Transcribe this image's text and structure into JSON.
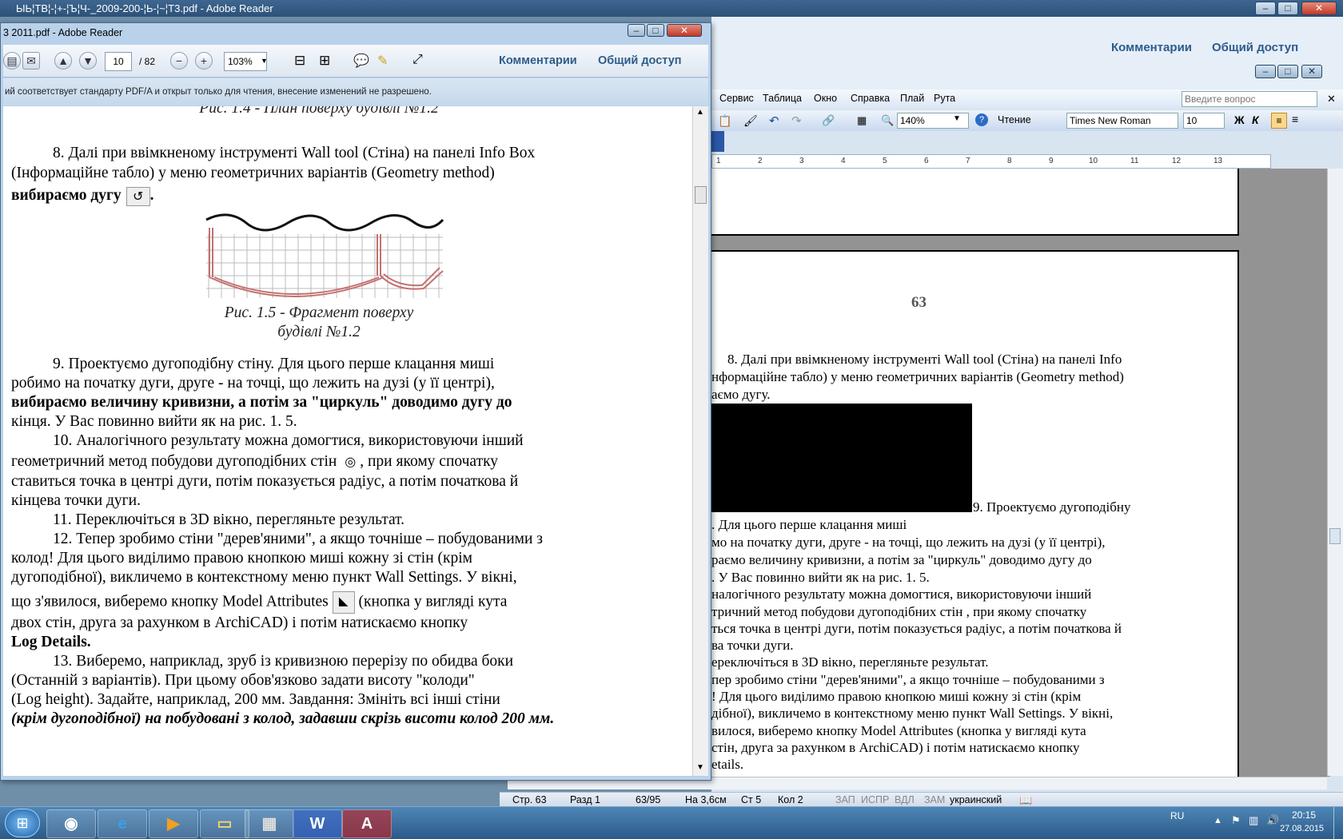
{
  "background_window": {
    "title": "ЫЬ¦ТВ¦-¦+-¦Ъ¦Ч-_2009-200-¦Ь-¦~¦Т3.pdf - Adobe Reader",
    "links": [
      "Комментарии",
      "Общий доступ"
    ]
  },
  "word": {
    "menu": [
      "Сервис",
      "Таблица",
      "Окно",
      "Справка",
      "Плай",
      "Рута"
    ],
    "search_placeholder": "Введите вопрос",
    "zoom": "140%",
    "view_mode": "Чтение",
    "font_name": "Times New Roman",
    "font_size": "10",
    "bold": "Ж",
    "italic": "К",
    "ruler_ticks": [
      "1",
      "2",
      "3",
      "4",
      "5",
      "6",
      "7",
      "8",
      "9",
      "10",
      "11",
      "12",
      "13"
    ],
    "page_number": "63",
    "lines": [
      "8. Далі при ввімкненому інструменті Wall tool (Стіна) на панелі Info",
      "нформаційне табло) у меню геометричних варіантів (Geometry method)",
      "аємо дугу.",
      "9. Проектуємо дугоподібну",
      ". Для цього перше клацання миші",
      "мо на початку дуги, друге - на точці, що лежить на дузі (у її центрі),",
      "раємо величину кривизни, а потім за \"циркуль\" доводимо дугу до",
      ". У Вас повинно вийти як на рис. 1. 5.",
      "налогічного результату можна домогтися, використовуючи інший",
      "тричний метод побудови дугоподібних стін , при якому спочатку",
      "ться точка в центрі дуги, потім показується радіус, а потім початкова й",
      "ва точки дуги.",
      "ереключіться в 3D вікно, перегляньте результат.",
      "пер зробимо стіни \"дерев'яними\", а якщо точніше – побудованими з",
      "! Для цього виділимо правою кнопкою миші кожну зі стін (крім",
      "дібної), викличемо в контекстному меню пункт Wall Settings. У вікні,",
      "вилося, виберемо кнопку Model Attributes (кнопка у вигляді кута",
      "стін, друга за рахунком в ArchiCAD) і потім натискаємо кнопку",
      "etails."
    ],
    "status": {
      "page": "Стр. 63",
      "section": "Разд 1",
      "pages": "63/95",
      "at": "На 3,6см",
      "line": "Ст 5",
      "col": "Кол 2",
      "rec": "ЗАП",
      "trk": "ИСПР",
      "ext": "ВДЛ",
      "ovr": "ЗАМ",
      "lang": "украинский"
    }
  },
  "reader": {
    "title": "3 2011.pdf - Adobe Reader",
    "page_current": "10",
    "page_total": "/ 82",
    "zoom": "103%",
    "links": [
      "Комментарии",
      "Общий доступ"
    ],
    "info_bar": "ий соответствует стандарту PDF/A и открыт только для чтения, внесение изменений не разрешено.",
    "doc": {
      "prev_caption": "Рис. 1.4 - План поверху будівлі №1.2",
      "caption_line1": "Рис. 1.5 - Фрагмент поверху",
      "caption_line2": "будівлі №1.2",
      "lines": [
        "8. Далі при ввімкненому інструменті Wall tool (Стіна) на панелі Info Box",
        "(Інформаційне табло) у меню геометричних варіантів (Geometry method)",
        "вибираємо дугу",
        "9. Проектуємо дугоподібну стіну. Для цього перше клацання миші",
        "робимо на початку дуги, друге - на точці, що лежить на дузі (у її центрі),",
        "вибираємо величину кривизни, а потім за \"циркуль\" доводимо дугу до",
        "кінця. У Вас повинно вийти як на рис. 1. 5.",
        "10. Аналогічного результату можна домогтися, використовуючи інший",
        "геометричний метод побудови дугоподібних стін",
        ", при якому спочатку",
        "ставиться точка в центрі дуги, потім показується радіус, а потім початкова й",
        "кінцева точки дуги.",
        "11. Переключіться в 3D вікно, перегляньте результат.",
        "12. Тепер зробимо стіни \"дерев'яними\", а якщо точніше – побудованими з",
        "колод! Для цього виділимо правою кнопкою миші кожну зі стін (крім",
        "дугоподібної), викличемо в контекстному меню пункт Wall Settings. У вікні,",
        "що з'явилося, виберемо кнопку Model Attributes",
        "(кнопка у вигляді кута",
        "двох стін, друга за рахунком в ArchiCAD) і потім натискаємо кнопку",
        "Log Details.",
        "13. Виберемо, наприклад, зруб із кривизною перерізу по обидва боки",
        "(Останній з варіантів). При цьому обов'язково задати висоту \"колоди\"",
        "(Log height). Задайте, наприклад, 200 мм. Завдання: Змініть всі інші стіни",
        "(крім дугоподібної) на побудовані з колод, задавши скрізь висоти колод 200 мм."
      ]
    }
  },
  "taskbar": {
    "lang": "RU",
    "time": "20:15",
    "date": "27.08.2015"
  }
}
